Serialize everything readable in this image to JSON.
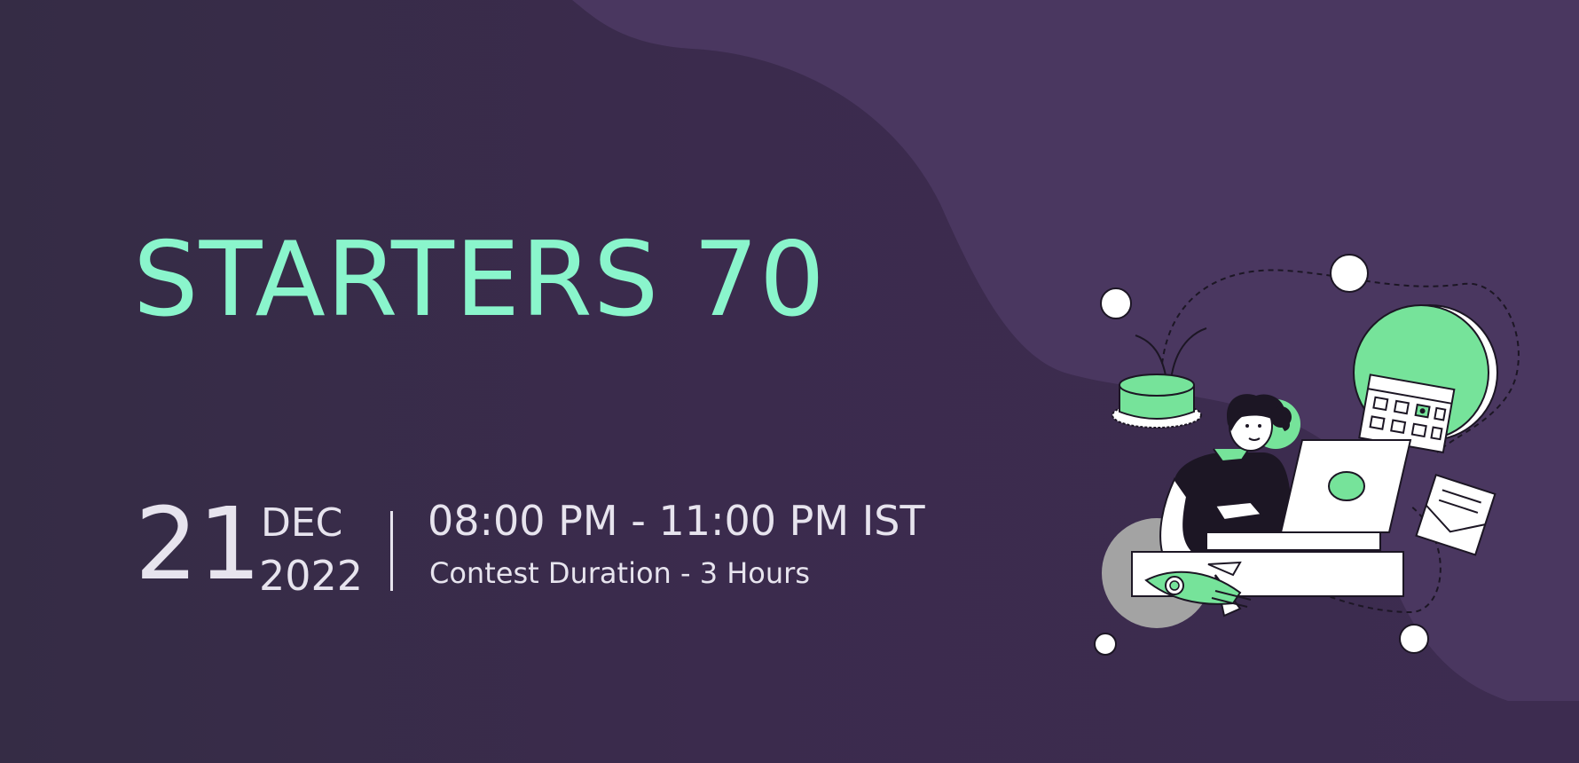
{
  "banner": {
    "title": "STARTERS 70",
    "date": {
      "day": "21",
      "month": "DEC",
      "year": "2022"
    },
    "time_range": "08:00 PM - 11:00 PM IST",
    "duration": "Contest Duration - 3 Hours",
    "illustration": {
      "icon": "person-at-laptop-icon",
      "elements": [
        "cake-icon",
        "calendar-icon",
        "rocket-icon",
        "envelope-icon",
        "laptop-icon"
      ]
    }
  },
  "colors": {
    "background": "#3b2b4d",
    "background_shape": "#4a3760",
    "accent": "#8af5cc",
    "illustration_green": "#76e39a",
    "text": "#e7e4ee"
  }
}
